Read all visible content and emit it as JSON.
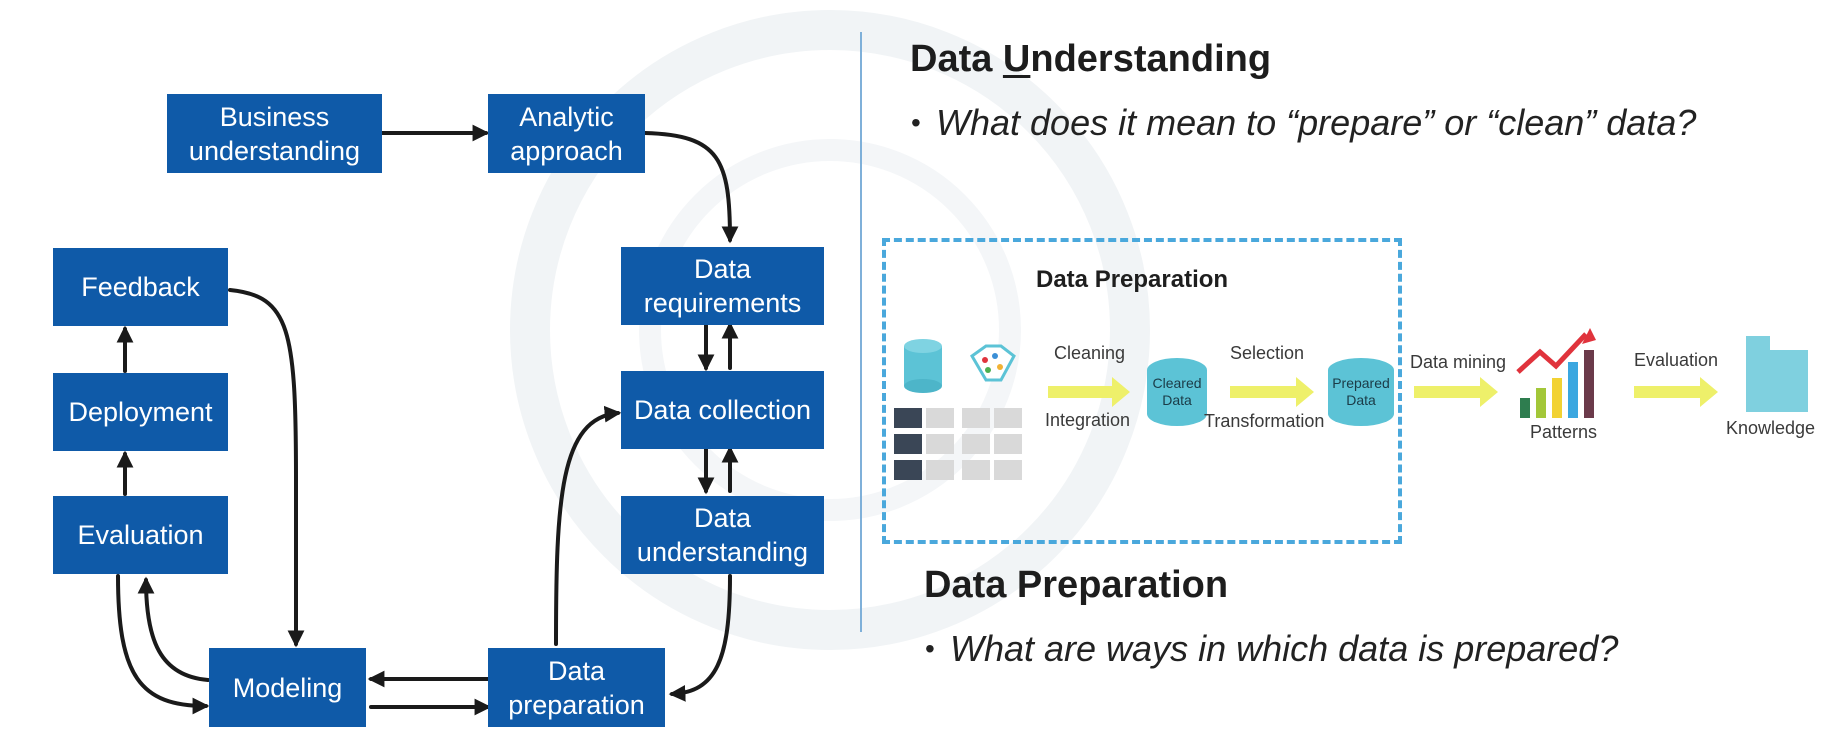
{
  "flow": {
    "business": "Business\nunderstanding",
    "analytic": "Analytic\napproach",
    "requirements": "Data\nrequirements",
    "collection": "Data collection",
    "understanding": "Data\nunderstanding",
    "preparation": "Data\npreparation",
    "modeling": "Modeling",
    "evaluation": "Evaluation",
    "deployment": "Deployment",
    "feedback": "Feedback"
  },
  "right": {
    "heading1_pre": "Data ",
    "heading1_u": "U",
    "heading1_post": "nderstanding",
    "bullet1": "What does it mean to “prepare” or “clean” data?",
    "heading2": "Data Preparation",
    "bullet2": "What are ways in which data is prepared?",
    "bullet_dot": "•"
  },
  "figure": {
    "title": "Data Preparation",
    "cleaning": "Cleaning",
    "integration": "Integration",
    "cleared": "Cleared\nData",
    "selection": "Selection",
    "transformation": "Transformation",
    "prepared": "Prepared\nData",
    "data_mining": "Data mining",
    "patterns": "Patterns",
    "evaluation": "Evaluation",
    "knowledge": "Knowledge"
  },
  "colors": {
    "box": "#0f5aa8",
    "arrow": "#1a1a1a",
    "dashed": "#4aa8dc",
    "yellow_arrow": "#eef06a",
    "cylinder": "#5cc3d6",
    "trend": "#e0333c"
  }
}
